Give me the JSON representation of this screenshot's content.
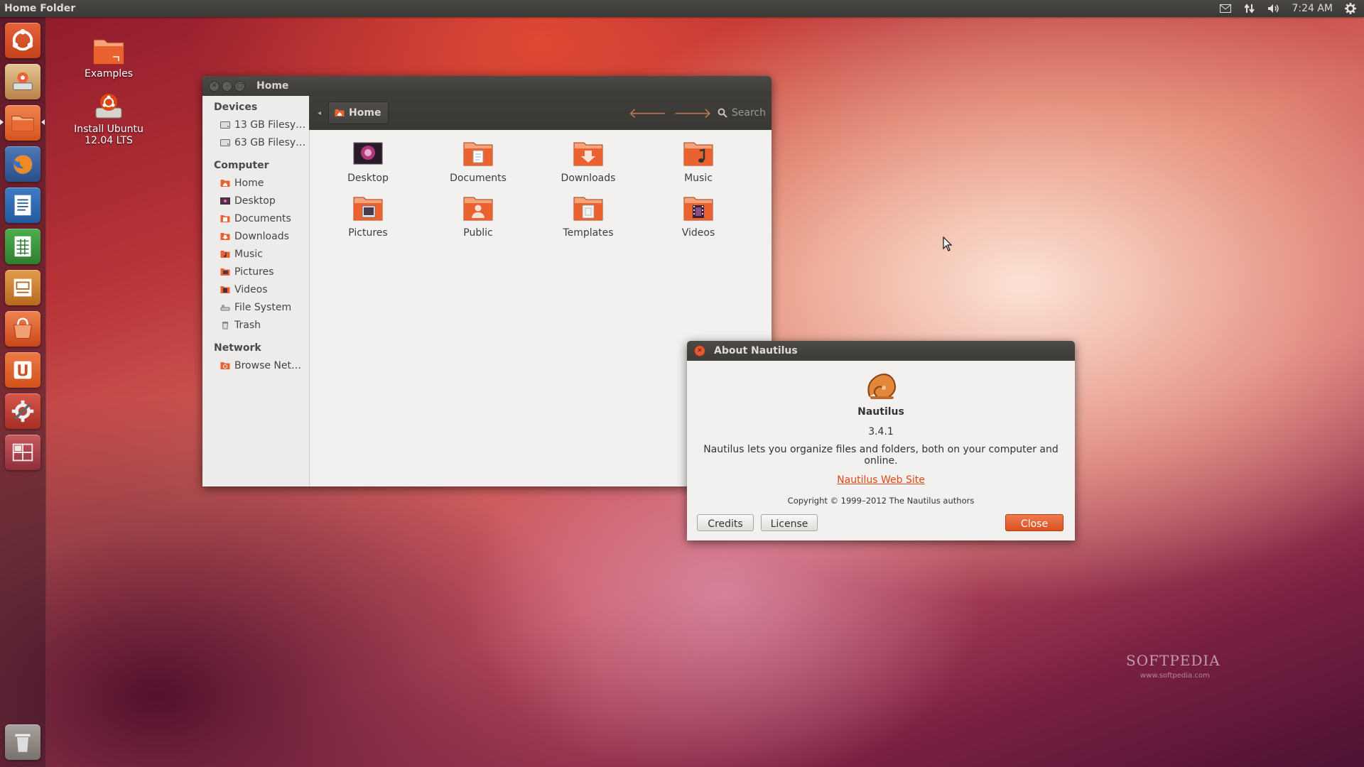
{
  "top_panel": {
    "title": "Home Folder",
    "clock": "7:24 AM",
    "icons": [
      "mail-icon",
      "network-icon",
      "volume-icon",
      "power-gear-icon"
    ]
  },
  "launcher": {
    "items": [
      "dash-icon",
      "installer-icon",
      "home-folder-icon",
      "firefox-icon",
      "writer-icon",
      "calc-icon",
      "impress-icon",
      "software-center-icon",
      "ubuntu-one-icon",
      "system-settings-icon",
      "workspace-switcher-icon",
      "trash-icon"
    ]
  },
  "desktop": {
    "icons": [
      {
        "label": "Examples",
        "icon": "examples-folder-icon"
      },
      {
        "label": "Install Ubuntu 12.04 LTS",
        "icon": "install-ubuntu-icon"
      }
    ]
  },
  "nautilus": {
    "title": "Home",
    "breadcrumb": "Home",
    "search_label": "Search",
    "sidebar": {
      "devices_header": "Devices",
      "devices": [
        "13 GB Filesy…",
        "63 GB Filesy…"
      ],
      "computer_header": "Computer",
      "computer": [
        "Home",
        "Desktop",
        "Documents",
        "Downloads",
        "Music",
        "Pictures",
        "Videos",
        "File System",
        "Trash"
      ],
      "network_header": "Network",
      "network": [
        "Browse Net…"
      ]
    },
    "files": [
      "Desktop",
      "Documents",
      "Downloads",
      "Music",
      "Pictures",
      "Public",
      "Templates",
      "Videos"
    ]
  },
  "about": {
    "title": "About Nautilus",
    "name": "Nautilus",
    "version": "3.4.1",
    "description": "Nautilus lets you organize files and folders, both on your computer and online.",
    "link": "Nautilus Web Site",
    "copyright": "Copyright © 1999–2012 The Nautilus authors",
    "buttons": {
      "credits": "Credits",
      "license": "License",
      "close": "Close"
    }
  },
  "watermark": {
    "brand": "SOFTPEDIA",
    "url": "www.softpedia.com"
  },
  "colors": {
    "accent": "#dd4814",
    "panel": "#3c3b37",
    "window_bg": "#f2f1f0"
  }
}
